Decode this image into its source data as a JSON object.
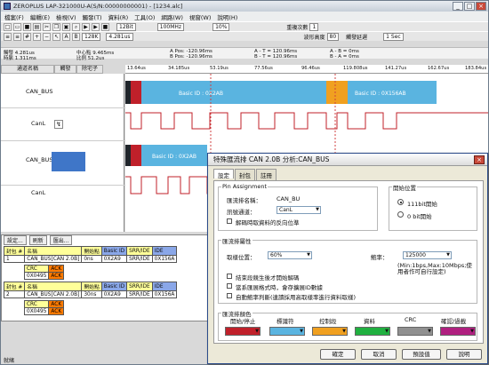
{
  "window": {
    "title": "ZEROPLUS LAP-321000U-A(S/N:00000000001) - [1234.alc]"
  },
  "menu": [
    "檔案(F)",
    "編輯(E)",
    "檢視(V)",
    "觸發(T)",
    "資料(R)",
    "工具(O)",
    "網路(W)",
    "視窗(W)",
    "說明(H)"
  ],
  "toolbar": {
    "icons": [
      "new-icon",
      "open-icon",
      "save-icon",
      "print-icon",
      "cut-icon",
      "copy-icon",
      "paste-icon",
      "zoom-in-icon",
      "zoom-out-icon",
      "cursor-icon",
      "find-icon",
      "run-icon",
      "stop-icon"
    ],
    "bits": "12Bit",
    "freq": "100MHz",
    "zoom": "10%",
    "repeat_label": "重複次數",
    "repeat": "1",
    "k_label": "128K",
    "mem": "4.281us",
    "waveform_height_label": "波形高度",
    "waveform_height": "80",
    "trigger_delay_label": "觸發延遲",
    "trigger_delay": "1 Sec"
  },
  "status": {
    "a": "觸發 4.281us",
    "b": "時脈 1.311ms",
    "c": "中心點 9.465ms",
    "d": "比例 51.2us",
    "e": "A Pos: -120.96ms",
    "f": "B Pos: -120.96ms",
    "g": "A - T = 120.96ms",
    "h": "B - T = 120.96ms",
    "i": "A - B = 0ms",
    "j": "B - A = 0ms"
  },
  "left": {
    "hdr_name": "通道名稱",
    "hdr_trigger": "觸發",
    "hdr_filter": "除宅子",
    "rows": [
      "CAN_BUS",
      "CanL",
      "CAN_BUS",
      "CanL"
    ]
  },
  "ruler": [
    "13.64us",
    "34.185us",
    "53.19us",
    "77.56us",
    "96.46us",
    "119.808us",
    "141.27us",
    "162.67us",
    "183.84us"
  ],
  "wave": {
    "id1": "Basic ID : 0X2AB",
    "id2": "Basic ID : 0X156AB",
    "id3": "Basic ID : 0X2AB"
  },
  "bottom": {
    "btn1": "設定...",
    "btn2": "刷新",
    "btn3": "匯出...",
    "hdr": [
      "封包 #",
      "名稱",
      "開始點",
      "Basic ID",
      "SRR/IDE",
      "IDE"
    ],
    "r1": [
      "1",
      "CAN_BUS[CAN 2.0B]",
      "0ns",
      "0X2A9",
      "SRR/IDE",
      "0X156A"
    ],
    "r1b": [
      "CRC",
      "ACK"
    ],
    "r1c": [
      "0X0495",
      "ACK"
    ],
    "r2": [
      "2",
      "CAN_BUS[CAN 2.0B]",
      "30ns",
      "0X2A9",
      "SRR/IDE",
      "0X156A"
    ],
    "r2b": [
      "CRC",
      "ACK"
    ],
    "r2c": [
      "0X0495",
      "ACK"
    ],
    "statusbar": "就緒"
  },
  "dialog": {
    "title": "特殊匯流排 CAN 2.0B 分析:CAN_BUS",
    "tabs": [
      "設定",
      "封包",
      "註冊"
    ],
    "pin_group": "Pin Assignment",
    "bus_name_label": "匯流排名稱：",
    "bus_name": "CAN_BU",
    "channel_label": "訊號通道：",
    "channel": "CanL",
    "invert_label": "解碼時取資料的反向位準",
    "start_group": "開始位置",
    "start_a": "111bit開始",
    "start_b": "0 bit開始",
    "attr_group": "匯流排屬性",
    "sample_label": "取樣位置：",
    "sample": "60%",
    "rate_label": "鮑率：",
    "rate": "125000",
    "rate_hint": "(Min:1bps,Max:10Mbps;使用者作可自行設定)",
    "opt1": "結束段競生後才開始解碼",
    "opt2": "當系匯展格式時，會存擴展ID數據",
    "opt3": "自動鮑率判斷(連讀採用高取樣率進行資料取樣)",
    "color_group": "匯流排顏色",
    "color_labels": [
      "開始/停止",
      "標識符",
      "控制段",
      "資料",
      "CRC",
      "確認/過載"
    ],
    "colors": [
      "#c0202a",
      "#5ab4e0",
      "#f0a020",
      "#20b040",
      "#909090",
      "#b02080"
    ],
    "ok": "確定",
    "cancel": "取消",
    "default": "預設值",
    "help": "說明"
  }
}
